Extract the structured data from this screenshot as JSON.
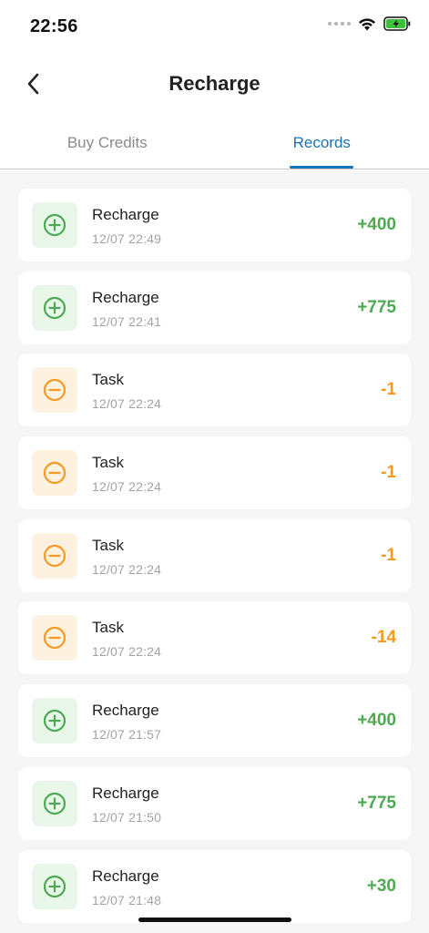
{
  "status_bar": {
    "time": "22:56"
  },
  "nav": {
    "title": "Recharge",
    "back_icon": "chevron-left-icon"
  },
  "tabs": [
    {
      "label": "Buy Credits",
      "active": false
    },
    {
      "label": "Records",
      "active": true
    }
  ],
  "colors": {
    "accent": "#1a73b8",
    "positive": "#4caa50",
    "negative": "#f49a23",
    "positive_bg": "#e9f6ea",
    "negative_bg": "#fff1e0"
  },
  "records": [
    {
      "type": "plus",
      "title": "Recharge",
      "time": "12/07 22:49",
      "amount": "+400"
    },
    {
      "type": "plus",
      "title": "Recharge",
      "time": "12/07 22:41",
      "amount": "+775"
    },
    {
      "type": "minus",
      "title": "Task",
      "time": "12/07 22:24",
      "amount": "-1"
    },
    {
      "type": "minus",
      "title": "Task",
      "time": "12/07 22:24",
      "amount": "-1"
    },
    {
      "type": "minus",
      "title": "Task",
      "time": "12/07 22:24",
      "amount": "-1"
    },
    {
      "type": "minus",
      "title": "Task",
      "time": "12/07 22:24",
      "amount": "-14"
    },
    {
      "type": "plus",
      "title": "Recharge",
      "time": "12/07 21:57",
      "amount": "+400"
    },
    {
      "type": "plus",
      "title": "Recharge",
      "time": "12/07 21:50",
      "amount": "+775"
    },
    {
      "type": "plus",
      "title": "Recharge",
      "time": "12/07 21:48",
      "amount": "+30"
    }
  ]
}
